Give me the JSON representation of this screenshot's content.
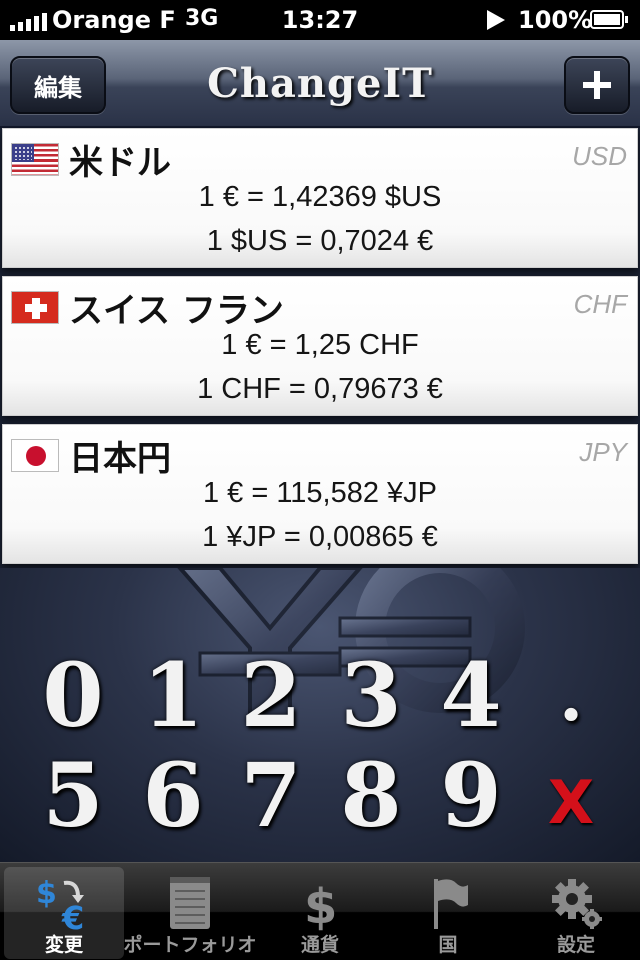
{
  "status_bar": {
    "carrier": "Orange F",
    "network": "3G",
    "time": "13:27",
    "battery": "100%",
    "icons": [
      "signal-icon",
      "play-icon",
      "battery-icon"
    ]
  },
  "nav": {
    "edit_label": "編集",
    "title": "ChangeIT",
    "add_icon": "plus-icon"
  },
  "currencies": [
    {
      "name": "米ドル",
      "code": "USD",
      "flag": "us-flag-icon",
      "rate_1": "1 € = 1,42369 $US",
      "rate_2": "1 $US = 0,7024 €"
    },
    {
      "name": "スイス フラン",
      "code": "CHF",
      "flag": "swiss-flag-icon",
      "rate_1": "1 € = 1,25 CHF",
      "rate_2": "1 CHF = 0,79673 €"
    },
    {
      "name": "日本円",
      "code": "JPY",
      "flag": "japan-flag-icon",
      "rate_1": "1 € = 115,582 ¥JP",
      "rate_2": "1 ¥JP = 0,00865 €"
    }
  ],
  "keypad": {
    "row1": [
      "0",
      "1",
      "2",
      "3",
      "4",
      "."
    ],
    "row2": [
      "5",
      "6",
      "7",
      "8",
      "9",
      "X"
    ],
    "delete_color": "#d4101a"
  },
  "tabs": [
    {
      "label": "変更",
      "icon": "exchange-icon",
      "active": true
    },
    {
      "label": "ポートフォリオ",
      "icon": "notepad-icon",
      "active": false
    },
    {
      "label": "通貨",
      "icon": "dollar-icon",
      "active": false
    },
    {
      "label": "国",
      "icon": "flag-icon",
      "active": false
    },
    {
      "label": "設定",
      "icon": "gear-icon",
      "active": false
    }
  ],
  "colors": {
    "accent_blue": "#2f86d8",
    "delete_red": "#d4101a"
  }
}
